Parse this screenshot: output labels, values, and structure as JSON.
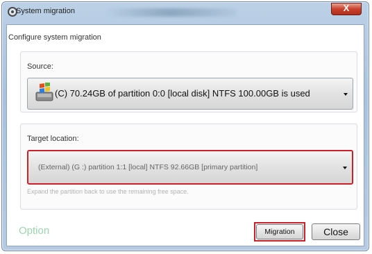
{
  "window": {
    "title": "System migration",
    "close_label": "X"
  },
  "dialog": {
    "subtitle": "Configure system migration"
  },
  "source": {
    "label": "Source:",
    "selected": "(C) 70.24GB of partition 0:0 [local disk] NTFS 100.00GB is used",
    "icon": "disk-windows-icon"
  },
  "target": {
    "label": "Target location:",
    "selected": "(External) (G :) partition 1:1 [local] NTFS 92.66GB [primary partition]",
    "hint": "Expand the partition back to use the remaining free space."
  },
  "footer": {
    "option_label": "Option",
    "migration_label": "Migration",
    "close_label": "Close"
  },
  "colors": {
    "highlight": "#cc1f27",
    "option_link": "#9ed3b0"
  }
}
